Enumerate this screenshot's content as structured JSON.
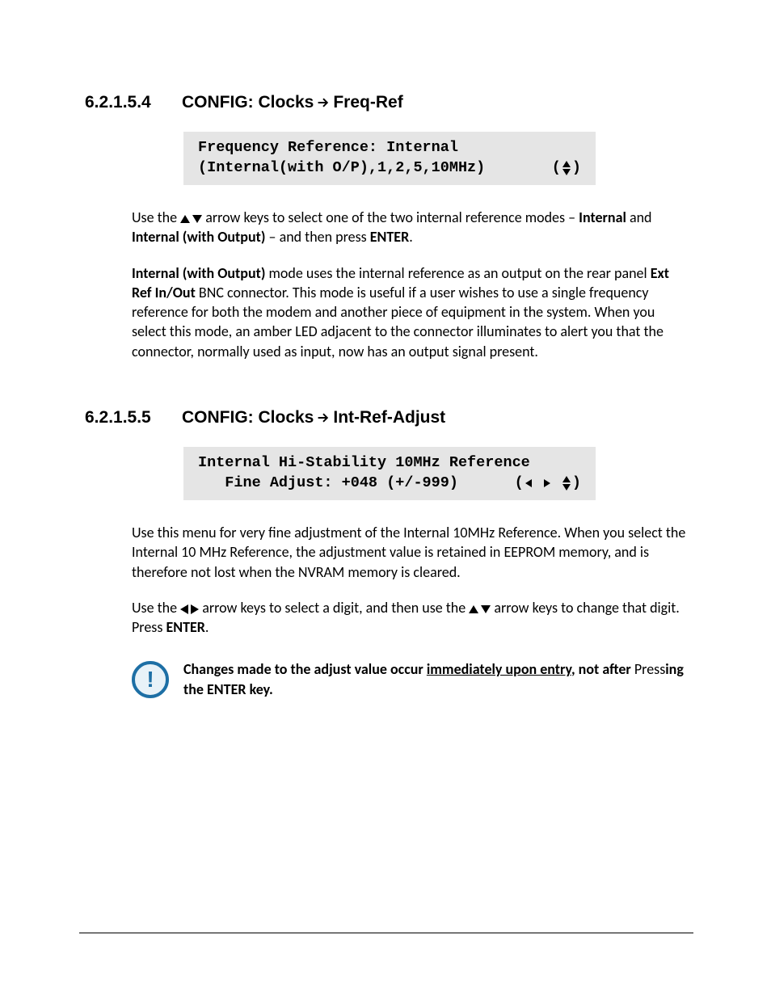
{
  "s1": {
    "num": "6.2.1.5.4",
    "title_a": "CONFIG: Clocks",
    "title_b": "Freq-Ref",
    "screen_l1": "Frequency Reference: Internal",
    "screen_l2": "(Internal(with O/P),1,2,5,10MHz)",
    "p1_a": "Use the ",
    "p1_b": " arrow keys to select one of the two internal reference modes – ",
    "p1_c": "Internal",
    "p1_d": " and ",
    "p1_e": "Internal (with Output)",
    "p1_f": " – and then press ",
    "p1_g": "ENTER",
    "p1_h": ".",
    "p2_a": "Internal (with Output)",
    "p2_b": " mode uses the internal reference as an output on the rear panel ",
    "p2_c": "Ext Ref In/Out",
    "p2_d": " BNC connector. This mode is useful if a user wishes to use a single frequency reference for both the modem and another piece of equipment in the system. When you select this mode, an amber LED adjacent to the connector illuminates to alert you that the connector, normally used as input, now has an output signal present."
  },
  "s2": {
    "num": "6.2.1.5.5",
    "title_a": "CONFIG: Clocks",
    "title_b": "Int-Ref-Adjust",
    "screen_l1": "Internal Hi-Stability 10MHz Reference",
    "screen_l2": "   Fine Adjust: +048 (+/-999)",
    "p1": "Use this menu for very fine adjustment of the Internal 10MHz Reference. When you select the Internal 10 MHz Reference, the adjustment value is retained in EEPROM memory, and is therefore not lost when the NVRAM memory is cleared.",
    "p2_a": "Use the ",
    "p2_b": " arrow keys to select a digit, and then use the ",
    "p2_c": " arrow keys to change that digit. Press ",
    "p2_d": "ENTER",
    "p2_e": ".",
    "note_a": "Changes made to the adjust value occur ",
    "note_b": "immediately upon entry",
    "note_c": ", not after ",
    "note_d": "Press",
    "note_e": "ing the ENTER key."
  }
}
